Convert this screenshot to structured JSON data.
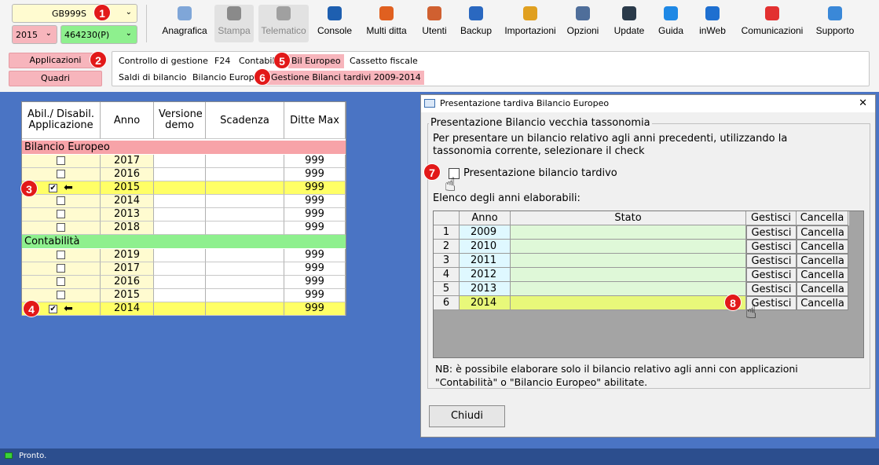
{
  "top": {
    "company": "GB999S",
    "year": "2015",
    "code": "464230(P)"
  },
  "toolbar": [
    {
      "label": "Anagrafica",
      "icon": "anagrafica-icon",
      "disabled": false
    },
    {
      "label": "Stampa",
      "icon": "print-icon",
      "disabled": true
    },
    {
      "label": "Telematico",
      "icon": "telematico-icon",
      "disabled": true
    },
    {
      "label": "Console",
      "icon": "console-icon",
      "disabled": false
    },
    {
      "label": "Multi ditta",
      "icon": "multi-ditta-icon",
      "disabled": false
    },
    {
      "label": "Utenti",
      "icon": "users-icon",
      "disabled": false
    },
    {
      "label": "Backup",
      "icon": "backup-icon",
      "disabled": false
    },
    {
      "label": "Importazioni",
      "icon": "import-icon",
      "disabled": false
    },
    {
      "label": "Opzioni",
      "icon": "gear-icon",
      "disabled": false
    },
    {
      "label": "Update",
      "icon": "update-icon",
      "disabled": false
    },
    {
      "label": "Guida",
      "icon": "help-icon",
      "disabled": false
    },
    {
      "label": "inWeb",
      "icon": "inweb-icon",
      "disabled": false
    },
    {
      "label": "Comunicazioni",
      "icon": "megaphone-icon",
      "disabled": false
    },
    {
      "label": "Supporto",
      "icon": "support-icon",
      "disabled": false
    }
  ],
  "side": {
    "applicazioni": "Applicazioni",
    "quadri": "Quadri"
  },
  "nav": {
    "row1": [
      "Controllo di gestione",
      "F24",
      "Contabili",
      "Bil Europeo",
      "Cassetto fiscale"
    ],
    "row2": [
      "Saldi di bilancio",
      "Bilancio Europe",
      "Gestione Bilanci tardivi 2009-2014"
    ]
  },
  "markers": [
    "1",
    "2",
    "3",
    "4",
    "5",
    "6",
    "7",
    "8"
  ],
  "grid": {
    "headers": [
      "Abil./ Disabil. Applicazione",
      "Anno",
      "Versione demo",
      "Scadenza",
      "Ditte Max"
    ],
    "groups": [
      {
        "name": "Bilancio Europeo",
        "color": "#f7a3a8",
        "rows": [
          {
            "checked": false,
            "year": "2017",
            "max": "999"
          },
          {
            "checked": false,
            "year": "2016",
            "max": "999"
          },
          {
            "checked": true,
            "year": "2015",
            "max": "999"
          },
          {
            "checked": false,
            "year": "2014",
            "max": "999"
          },
          {
            "checked": false,
            "year": "2013",
            "max": "999"
          },
          {
            "checked": false,
            "year": "2018",
            "max": "999"
          }
        ]
      },
      {
        "name": "Contabilità",
        "color": "#8ef08e",
        "rows": [
          {
            "checked": false,
            "year": "2019",
            "max": "999"
          },
          {
            "checked": false,
            "year": "2017",
            "max": "999"
          },
          {
            "checked": false,
            "year": "2016",
            "max": "999"
          },
          {
            "checked": false,
            "year": "2015",
            "max": "999"
          },
          {
            "checked": true,
            "year": "2014",
            "max": "999"
          }
        ]
      }
    ]
  },
  "dialog": {
    "title": "Presentazione tardiva Bilancio Europeo",
    "close": "✕",
    "group_title": "Presentazione Bilancio vecchia tassonomia",
    "desc": "Per presentare un bilancio relativo agli anni precedenti, utilizzando la tassonomia corrente, selezionare il check",
    "checkbox_label": "Presentazione bilancio tardivo",
    "list_label": "Elenco degli anni elaborabili:",
    "table_headers": [
      "",
      "Anno",
      "Stato",
      "Gestisci",
      "Cancella"
    ],
    "rows": [
      {
        "n": "1",
        "year": "2009"
      },
      {
        "n": "2",
        "year": "2010"
      },
      {
        "n": "3",
        "year": "2011"
      },
      {
        "n": "4",
        "year": "2012"
      },
      {
        "n": "5",
        "year": "2013"
      },
      {
        "n": "6",
        "year": "2014"
      }
    ],
    "btn_gestisci": "Gestisci",
    "btn_cancella": "Cancella",
    "note": "NB: è possibile elaborare solo il bilancio relativo agli anni con applicazioni \"Contabilità\" o \"Bilancio Europeo\" abilitate.",
    "chiudi": "Chiudi"
  },
  "status": "Pronto."
}
